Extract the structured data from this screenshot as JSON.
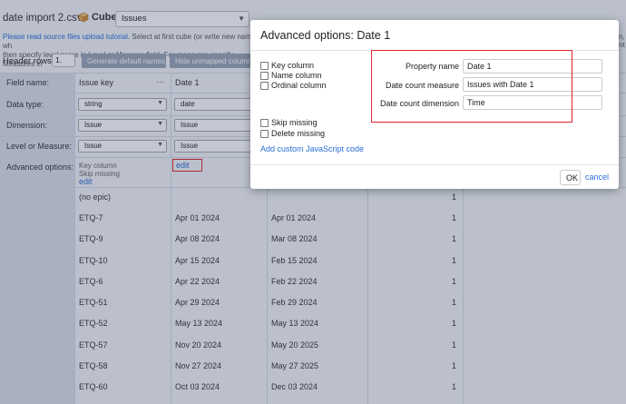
{
  "file": {
    "name": "date import 2.csv"
  },
  "cube": {
    "label": "Cube:",
    "value": "Issues"
  },
  "help": {
    "link_text": "Please read source files upload tutorial.",
    "line1_rest": " Select at first cube (or write new name) wh",
    "line2": "then specify level name in Level or Measure field. For measures specify Measures in",
    "right_clip1": "n,",
    "right_clip2": "nt"
  },
  "header_rows": {
    "label": "Header rows",
    "value": "1."
  },
  "buttons": {
    "generate": "Generate default names",
    "hide_unmapped": "Hide unmapped columns"
  },
  "row_labels": {
    "field_name": "Field name:",
    "data_type": "Data type:",
    "dimension": "Dimension:",
    "level": "Level or Measure:",
    "advanced": "Advanced options:"
  },
  "columns": {
    "issue_key": {
      "name": "Issue key",
      "more": "···",
      "data_type": "string",
      "dimension": "Issue",
      "level": "Issue",
      "adv_line1": "Key column",
      "adv_line2": "Skip missing",
      "edit": "edit"
    },
    "date1": {
      "name": "Date 1",
      "data_type": "date",
      "dimension": "Issue",
      "level": "Issue",
      "edit": "edit"
    }
  },
  "rows": [
    {
      "key": "(no epic)",
      "d1": "",
      "d2": "",
      "count": "1"
    },
    {
      "key": "ETQ-7",
      "d1": "Apr 01 2024",
      "d2": "Apr 01 2024",
      "count": "1"
    },
    {
      "key": "ETQ-9",
      "d1": "Apr 08 2024",
      "d2": "Mar 08 2024",
      "count": "1"
    },
    {
      "key": "ETQ-10",
      "d1": "Apr 15 2024",
      "d2": "Feb 15 2024",
      "count": "1"
    },
    {
      "key": "ETQ-6",
      "d1": "Apr 22 2024",
      "d2": "Feb 22 2024",
      "count": "1"
    },
    {
      "key": "ETQ-51",
      "d1": "Apr 29 2024",
      "d2": "Feb 29 2024",
      "count": "1"
    },
    {
      "key": "ETQ-52",
      "d1": "May 13 2024",
      "d2": "May 13 2024",
      "count": "1"
    },
    {
      "key": "ETQ-57",
      "d1": "Nov 20 2024",
      "d2": "May 20 2025",
      "count": "1"
    },
    {
      "key": "ETQ-58",
      "d1": "Nov 27 2024",
      "d2": "May 27 2025",
      "count": "1"
    },
    {
      "key": "ETQ-60",
      "d1": "Oct 03 2024",
      "d2": "Dec 03 2024",
      "count": "1"
    }
  ],
  "dialog": {
    "title": "Advanced options: Date 1",
    "checkboxes": {
      "key": "Key column",
      "name": "Name column",
      "ordinal": "Ordinal column",
      "skip": "Skip missing",
      "delete": "Delete missing"
    },
    "js_link": "Add custom JavaScript code",
    "props": {
      "property_name_label": "Property name",
      "property_name_value": "Date 1",
      "date_count_measure_label": "Date count measure",
      "date_count_measure_value": "Issues with Date 1",
      "date_count_dimension_label": "Date count dimension",
      "date_count_dimension_value": "Time"
    },
    "ok": "OK",
    "cancel": "cancel"
  },
  "colors": {
    "link": "#2a6fd6",
    "highlight": "#e0242c",
    "button": "#9aa6b6"
  }
}
